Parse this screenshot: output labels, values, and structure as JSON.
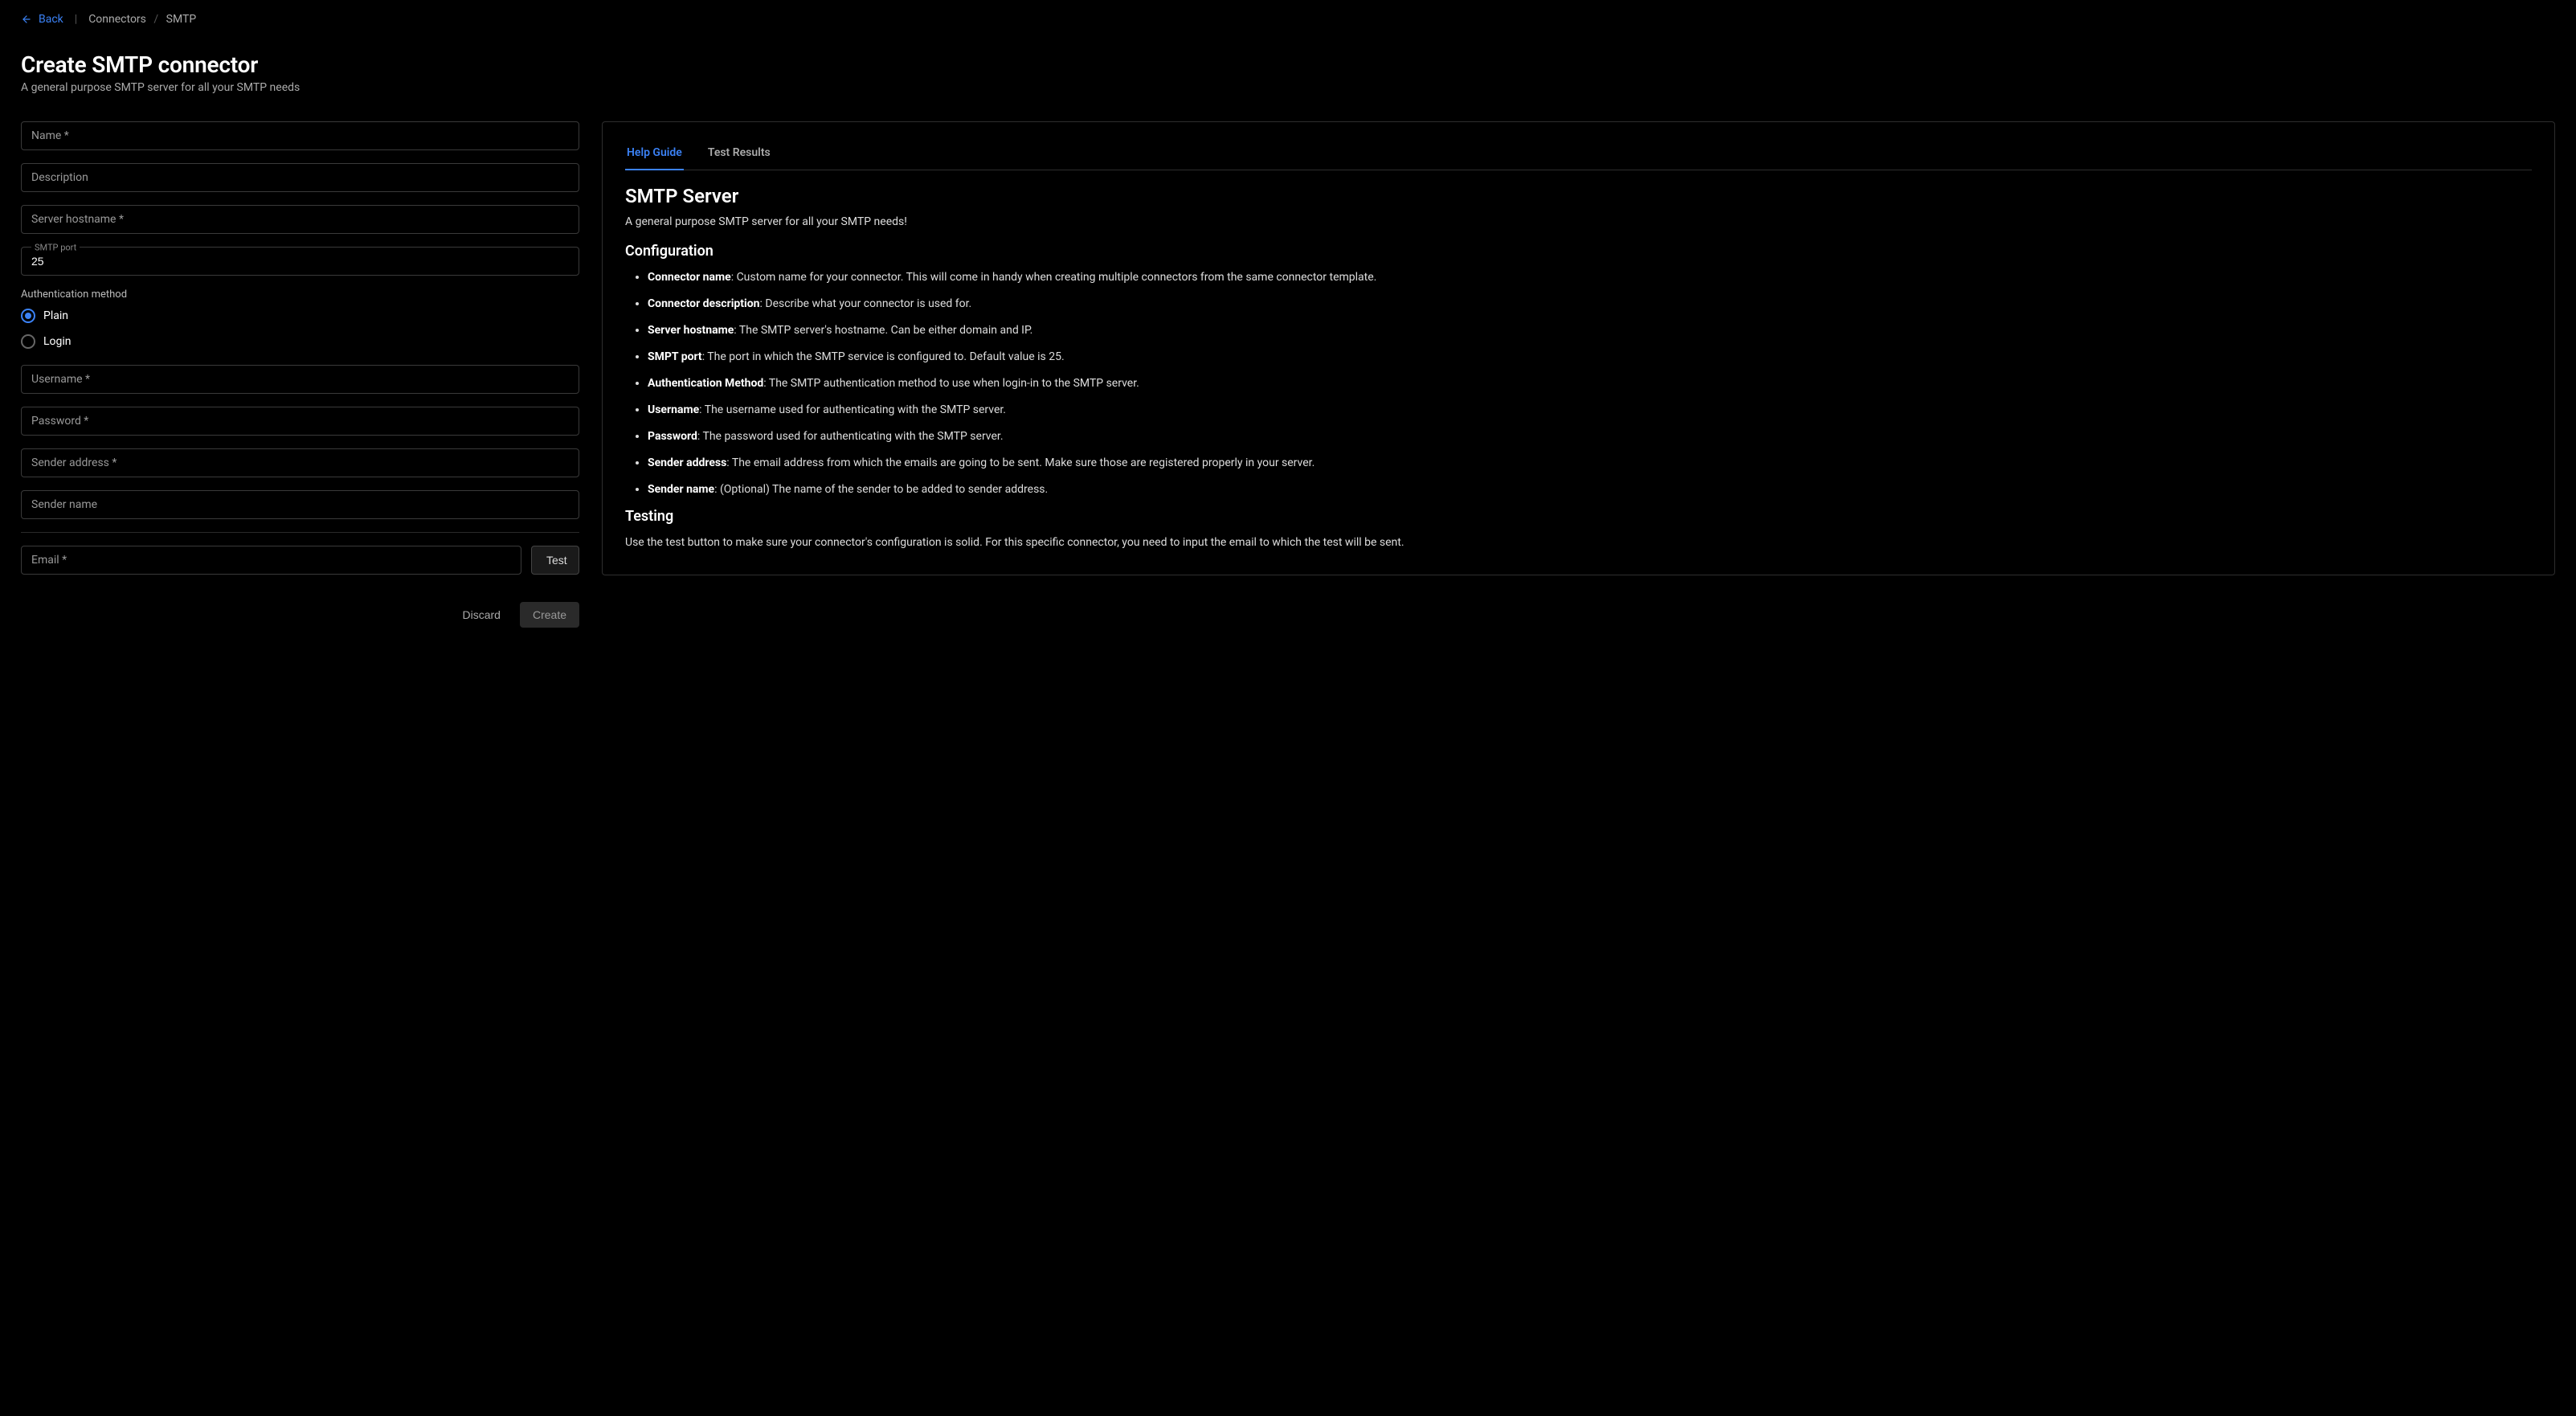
{
  "nav": {
    "back_label": "Back",
    "crumb_root": "Connectors",
    "crumb_current": "SMTP"
  },
  "header": {
    "title": "Create SMTP connector",
    "subtitle": "A general purpose SMTP server for all your SMTP needs"
  },
  "form": {
    "name_label": "Name *",
    "description_label": "Description",
    "hostname_label": "Server hostname *",
    "port_label": "SMTP port",
    "port_value": "25",
    "auth_group_label": "Authentication method",
    "auth_plain_label": "Plain",
    "auth_login_label": "Login",
    "auth_selected": "plain",
    "username_label": "Username *",
    "password_label": "Password *",
    "sender_address_label": "Sender address *",
    "sender_name_label": "Sender name",
    "email_label": "Email *",
    "test_button": "Test",
    "discard_button": "Discard",
    "create_button": "Create"
  },
  "tabs": {
    "help": "Help Guide",
    "results": "Test Results",
    "active": "help"
  },
  "help": {
    "title": "SMTP Server",
    "lead": "A general purpose SMTP server for all your SMTP needs!",
    "config_heading": "Configuration",
    "items": [
      {
        "term": "Connector name",
        "desc": ": Custom name for your connector. This will come in handy when creating multiple connectors from the same connector template."
      },
      {
        "term": "Connector description",
        "desc": ": Describe what your connector is used for."
      },
      {
        "term": "Server hostname",
        "desc": ": The SMTP server's hostname. Can be either domain and IP."
      },
      {
        "term": "SMPT port",
        "desc": ": The port in which the SMTP service is configured to. Default value is 25."
      },
      {
        "term": "Authentication Method",
        "desc": ": The SMTP authentication method to use when login-in to the SMTP server."
      },
      {
        "term": "Username",
        "desc": ": The username used for authenticating with the SMTP server."
      },
      {
        "term": "Password",
        "desc": ": The password used for authenticating with the SMTP server."
      },
      {
        "term": "Sender address",
        "desc": ": The email address from which the emails are going to be sent. Make sure those are registered properly in your server."
      },
      {
        "term": "Sender name",
        "desc": ": (Optional) The name of the sender to be added to sender address."
      }
    ],
    "testing_heading": "Testing",
    "testing_body": "Use the test button to make sure your connector's configuration is solid. For this specific connector, you need to input the email to which the test will be sent."
  }
}
